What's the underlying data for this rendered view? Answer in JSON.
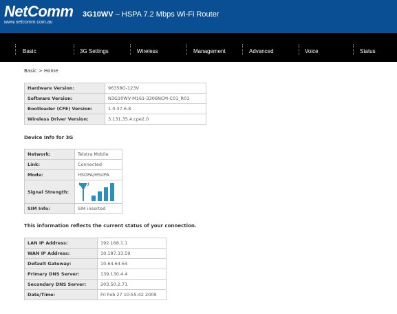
{
  "header": {
    "logo": "NetComm",
    "logo_url": "www.netcomm.com.au",
    "model": "3G10WV",
    "subtitle": " – HSPA 7.2 Mbps Wi-Fi Router"
  },
  "nav": {
    "items": [
      "Basic",
      "3G Settings",
      "Wireless",
      "Management",
      "Advanced",
      "Voice",
      "Status"
    ]
  },
  "breadcrumb": "Basic > Home",
  "device": {
    "rows": [
      {
        "label": "Hardware Version:",
        "value": "96358G-123V"
      },
      {
        "label": "Software Version:",
        "value": "N3G10WV-M161-3306NCM-C01_R01"
      },
      {
        "label": "Bootloader (CFE) Version:",
        "value": "1.0.37-6.8"
      },
      {
        "label": "Wireless Driver Version:",
        "value": "3.131.35.4.cpe2.0"
      }
    ]
  },
  "device_3g": {
    "title": "Device Info for 3G",
    "rows": [
      {
        "label": "Network:",
        "value": "Telstra Mobile"
      },
      {
        "label": "Link:",
        "value": "Connected"
      },
      {
        "label": "Mode:",
        "value": "HSDPA/HSUPA"
      },
      {
        "label": "Signal Strength:",
        "value": ""
      },
      {
        "label": "SIM Info:",
        "value": "SIM inserted"
      }
    ],
    "signal_level": 1.0,
    "signal_icon": "signal-strength-icon"
  },
  "connection": {
    "note": "This information reflects the current status of your connection.",
    "rows": [
      {
        "label": "LAN IP Address:",
        "value": "192.168.1.1"
      },
      {
        "label": "WAN IP Address:",
        "value": "10.187.33.59"
      },
      {
        "label": "Default Gateway:",
        "value": "10.64.64.64"
      },
      {
        "label": "Primary DNS Server:",
        "value": "139.130.4.4"
      },
      {
        "label": "Secondary DNS Server:",
        "value": "203.50.2.71"
      },
      {
        "label": "Date/Time:",
        "value": "Fri Feb 27 10:55:42 2009"
      }
    ]
  },
  "colors": {
    "header_bg": "#0a4e93",
    "nav_bg": "#000000",
    "signal": "#2a8fc0"
  }
}
